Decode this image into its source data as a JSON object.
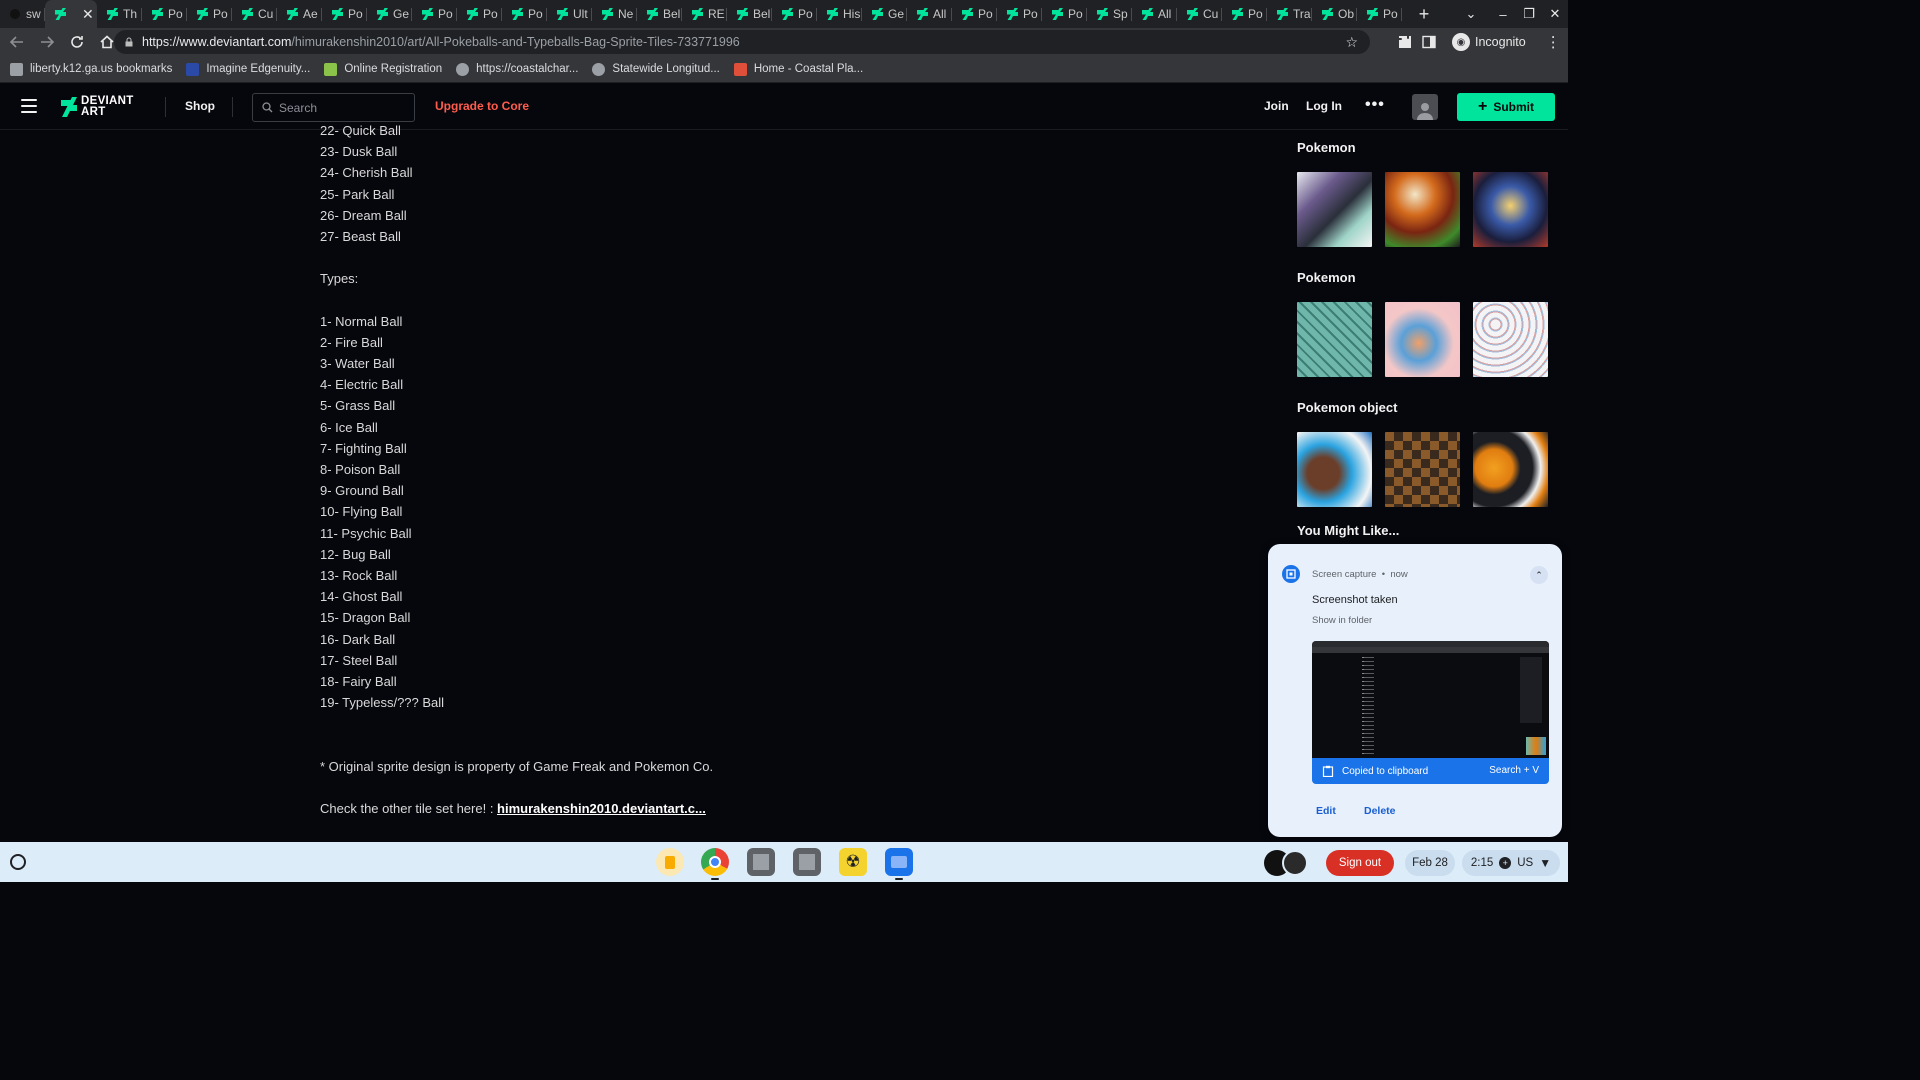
{
  "browser": {
    "tabs": [
      {
        "label": "sw",
        "active": false
      },
      {
        "label": "",
        "active": true
      },
      {
        "label": "Th"
      },
      {
        "label": "Po"
      },
      {
        "label": "Po"
      },
      {
        "label": "Cu"
      },
      {
        "label": "Ae"
      },
      {
        "label": "Po"
      },
      {
        "label": "Ge"
      },
      {
        "label": "Po"
      },
      {
        "label": "Po"
      },
      {
        "label": "Po"
      },
      {
        "label": "Ult"
      },
      {
        "label": "Ne"
      },
      {
        "label": "Bel"
      },
      {
        "label": "RE"
      },
      {
        "label": "Bel"
      },
      {
        "label": "Po"
      },
      {
        "label": "His"
      },
      {
        "label": "Ge"
      },
      {
        "label": "All"
      },
      {
        "label": "Po"
      },
      {
        "label": "Po"
      },
      {
        "label": "Po"
      },
      {
        "label": "Sp"
      },
      {
        "label": "All"
      },
      {
        "label": "Cu"
      },
      {
        "label": "Po"
      },
      {
        "label": "Tra"
      },
      {
        "label": "Ob"
      },
      {
        "label": "Po"
      }
    ],
    "close_glyph": "✕",
    "newtab_glyph": "+",
    "url_host": "https://www.deviantart.com",
    "url_path": "/himurakenshin2010/art/All-Pokeballs-and-Typeballs-Bag-Sprite-Tiles-733771996",
    "profile_label": "Incognito",
    "bookmarks": [
      {
        "label": "liberty.k12.ga.us bookmarks",
        "icon": "folder-icon",
        "color": "#9aa0a6"
      },
      {
        "label": "Imagine Edgenuity...",
        "icon": "edgenuity-icon",
        "color": "#2b4aa8"
      },
      {
        "label": "Online Registration",
        "icon": "registration-icon",
        "color": "#8bc34a"
      },
      {
        "label": "https://coastalchar...",
        "icon": "globe-icon",
        "color": "#9aa0a6"
      },
      {
        "label": "Statewide Longitud...",
        "icon": "globe-icon",
        "color": "#9aa0a6"
      },
      {
        "label": "Home - Coastal Pla...",
        "icon": "coastal-icon",
        "color": "#e04f3a"
      }
    ]
  },
  "header": {
    "logo_line1": "DEVIANT",
    "logo_line2": "ART",
    "shop": "Shop",
    "search_placeholder": "Search",
    "upgrade": "Upgrade to Core",
    "join": "Join",
    "login": "Log In",
    "more": "•••",
    "submit": "Submit",
    "accent": "#00e59b",
    "upgrade_color": "#ff5c4d"
  },
  "description": {
    "pokeballs": [
      "22- Quick Ball",
      "23- Dusk Ball",
      "24- Cherish Ball",
      "25- Park Ball",
      "26- Dream Ball",
      "27- Beast Ball"
    ],
    "types_heading": "Types:",
    "types": [
      "1- Normal Ball",
      "2- Fire Ball",
      "3- Water Ball",
      "4- Electric Ball",
      "5- Grass Ball",
      "6- Ice Ball",
      "7- Fighting Ball",
      "8- Poison Ball",
      "9- Ground Ball",
      "10- Flying Ball",
      "11- Psychic Ball",
      "12- Bug Ball",
      "13- Rock Ball",
      "14- Ghost Ball",
      "15- Dragon Ball",
      "16- Dark Ball",
      "17- Steel Ball",
      "18- Fairy Ball",
      "19- Typeless/??? Ball"
    ],
    "footnote": "* Original sprite design is property of Game Freak and Pokemon Co.",
    "check_text": "Check the other tile set here! : ",
    "check_link": "himurakenshin2010.deviantart.c..."
  },
  "sidebar": {
    "sections": [
      {
        "title": "Pokemon"
      },
      {
        "title": "Pokemon"
      },
      {
        "title": "Pokemon object"
      }
    ],
    "might_like": "You Might Like..."
  },
  "notification": {
    "source": "Screen capture",
    "time": "now",
    "separator": "•",
    "title": "Screenshot taken",
    "subtitle": "Show in folder",
    "clipboard": "Copied to clipboard",
    "shortcut": "Search + V",
    "edit": "Edit",
    "delete": "Delete"
  },
  "shelf": {
    "signout": "Sign out",
    "date": "Feb 28",
    "time": "2:15",
    "locale": "US"
  }
}
